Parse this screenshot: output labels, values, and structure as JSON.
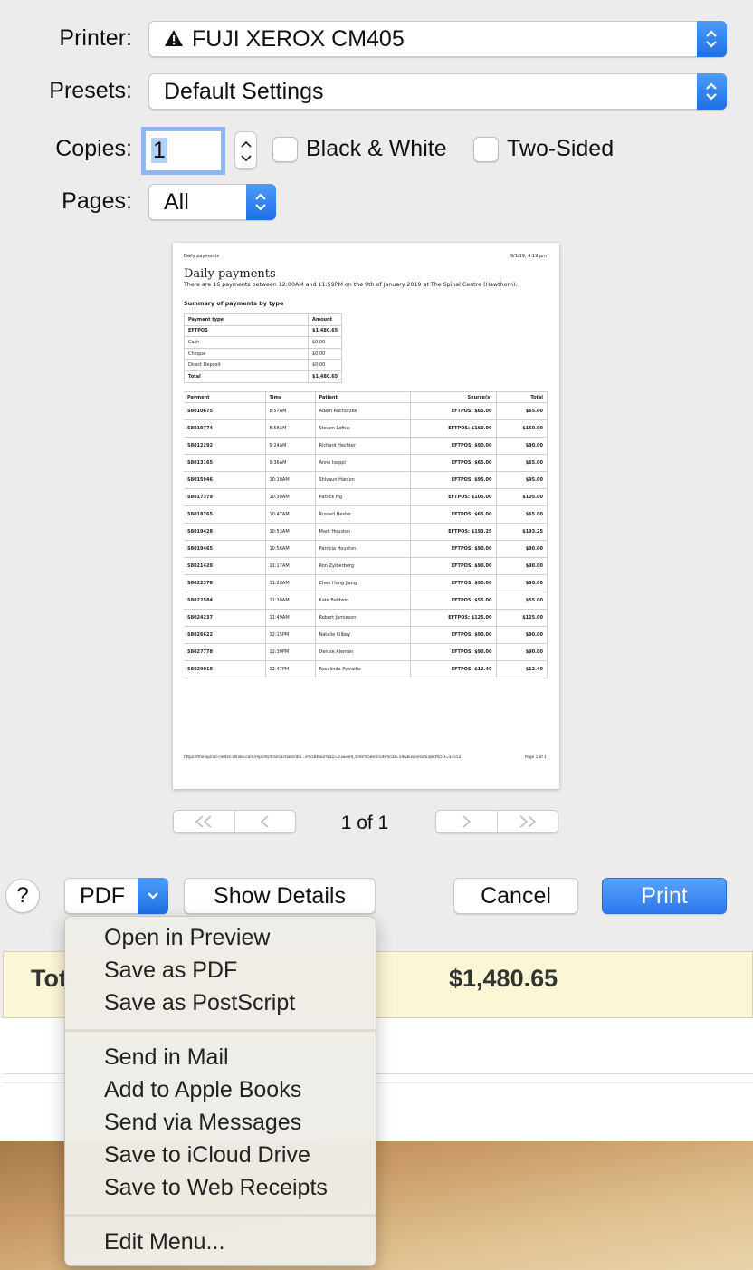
{
  "dialog": {
    "printer": {
      "label": "Printer:",
      "value": "FUJI XEROX CM405",
      "warning_icon": "warning-icon"
    },
    "presets": {
      "label": "Presets:",
      "value": "Default Settings"
    },
    "copies": {
      "label": "Copies:",
      "value": "1"
    },
    "black_white": {
      "label": "Black & White",
      "checked": false
    },
    "two_sided": {
      "label": "Two-Sided",
      "checked": false
    },
    "pages": {
      "label": "Pages:",
      "value": "All"
    }
  },
  "preview": {
    "header_left": "Daily payments",
    "header_right": "9/1/19, 4:19 pm",
    "title": "Daily payments",
    "subtitle": "There are 16 payments between 12:00AM and 11:59PM on the 9th of January 2019 at The Spinal Centre (Hawthorn).",
    "summary_heading": "Summary of payments by type",
    "summary_headers": [
      "Payment type",
      "Amount"
    ],
    "summary_rows": [
      [
        "EFTPOS",
        "$1,480.65"
      ],
      [
        "Cash",
        "$0.00"
      ],
      [
        "Cheque",
        "$0.00"
      ],
      [
        "Direct Deposit",
        "$0.00"
      ],
      [
        "Total",
        "$1,480.65"
      ]
    ],
    "payments_headers": [
      "Payment",
      "Time",
      "Patient",
      "Source(s)",
      "Total"
    ],
    "payments_rows": [
      [
        "S8010675",
        "8:57AM",
        "Adam Ruchotzke",
        "EFTPOS: $65.00",
        "$65.00"
      ],
      [
        "S8010774",
        "8:58AM",
        "Steven Loftus",
        "EFTPOS: $160.00",
        "$160.00"
      ],
      [
        "S8012292",
        "9:24AM",
        "Richard Hechter",
        "EFTPOS: $90.00",
        "$90.00"
      ],
      [
        "S8013165",
        "9:36AM",
        "Anne Iseppi",
        "EFTPOS: $65.00",
        "$65.00"
      ],
      [
        "S8015946",
        "10:10AM",
        "Shivaun Hanlon",
        "EFTPOS: $95.00",
        "$95.00"
      ],
      [
        "S8017379",
        "10:30AM",
        "Patrick Ng",
        "EFTPOS: $105.00",
        "$105.00"
      ],
      [
        "S8018765",
        "10:47AM",
        "Russell Hester",
        "EFTPOS: $65.00",
        "$65.00"
      ],
      [
        "S8019428",
        "10:53AM",
        "Mark Houston",
        "EFTPOS: $193.25",
        "$193.25"
      ],
      [
        "S8019465",
        "10:56AM",
        "Patricia Houston",
        "EFTPOS: $90.00",
        "$90.00"
      ],
      [
        "S8021429",
        "11:17AM",
        "Ron Zylberberg",
        "EFTPOS: $90.00",
        "$90.00"
      ],
      [
        "S8022378",
        "11:28AM",
        "Chen Hong Jiang",
        "EFTPOS: $90.00",
        "$90.00"
      ],
      [
        "S8022584",
        "11:30AM",
        "Kate Baldwin",
        "EFTPOS: $55.00",
        "$55.00"
      ],
      [
        "S8024237",
        "11:49AM",
        "Robert Jamieson",
        "EFTPOS: $125.00",
        "$125.00"
      ],
      [
        "S8026622",
        "12:15PM",
        "Natalie Kilbey",
        "EFTPOS: $90.00",
        "$90.00"
      ],
      [
        "S8027778",
        "12:30PM",
        "Denise Aleman",
        "EFTPOS: $90.00",
        "$90.00"
      ],
      [
        "S8029018",
        "12:47PM",
        "Rosalinda Petraitis",
        "EFTPOS: $12.40",
        "$12.40"
      ]
    ],
    "footer_left": "https://the-spinal-centre.cliniko.com/reports/transactions/dai...e%5Bhour%5D=23&end_time%5Bminute%5D=59&business%5Bid%5D=33552",
    "footer_right": "Page 1 of 1"
  },
  "pager": {
    "first": "<<",
    "prev": "<",
    "indicator": "1 of 1",
    "next": ">",
    "last": ">>"
  },
  "buttons": {
    "help": "?",
    "pdf": "PDF",
    "show_details": "Show Details",
    "cancel": "Cancel",
    "print": "Print"
  },
  "pdf_menu": {
    "group1": [
      "Open in Preview",
      "Save as PDF",
      "Save as PostScript"
    ],
    "group2": [
      "Send in Mail",
      "Add to Apple Books",
      "Send via Messages",
      "Save to iCloud Drive",
      "Save to Web Receipts"
    ],
    "group3": [
      "Edit Menu..."
    ]
  },
  "background": {
    "total_label": "Tot",
    "total_value": "$1,480.65"
  },
  "colors": {
    "accent": "#2c78ee",
    "menu_bg": "#eeece6",
    "total_row_bg": "#fbf6d6"
  }
}
